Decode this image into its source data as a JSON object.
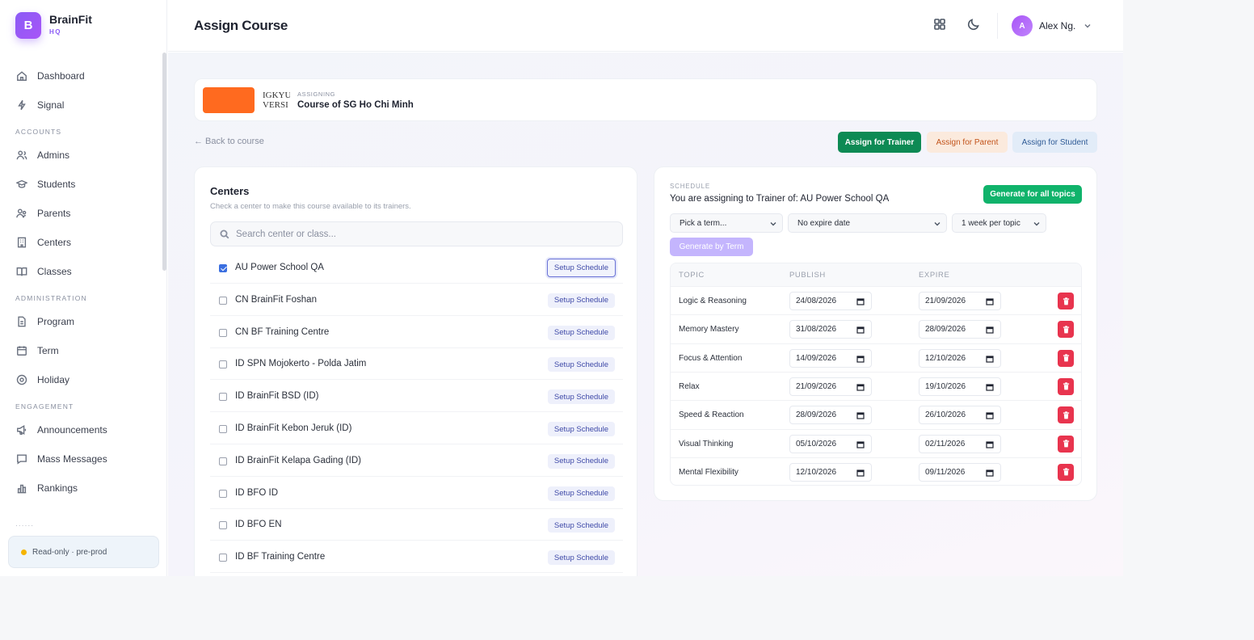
{
  "brand": {
    "logo_letter": "B",
    "name": "BrainFit",
    "sub": "HQ"
  },
  "sidebar": {
    "top_items": [
      {
        "label": "Dashboard",
        "icon": "home-icon"
      },
      {
        "label": "Signal",
        "icon": "signal-icon"
      }
    ],
    "sections": [
      {
        "title": "ACCOUNTS",
        "items": [
          {
            "label": "Admins",
            "icon": "users-icon"
          },
          {
            "label": "Students",
            "icon": "graduation-cap-icon"
          },
          {
            "label": "Parents",
            "icon": "parents-icon"
          },
          {
            "label": "Centers",
            "icon": "building-icon"
          },
          {
            "label": "Classes",
            "icon": "book-open-icon"
          }
        ]
      },
      {
        "title": "ADMINISTRATION",
        "items": [
          {
            "label": "Program",
            "icon": "document-icon"
          },
          {
            "label": "Term",
            "icon": "calendar-icon"
          },
          {
            "label": "Holiday",
            "icon": "holiday-icon"
          }
        ]
      },
      {
        "title": "ENGAGEMENT",
        "items": [
          {
            "label": "Announcements",
            "icon": "megaphone-icon"
          },
          {
            "label": "Mass Messages",
            "icon": "message-icon"
          },
          {
            "label": "Rankings",
            "icon": "bar-chart-icon"
          }
        ]
      }
    ],
    "readonly_label": "Read-only · pre-prod",
    "status_color": "#f5b400"
  },
  "header": {
    "title": "Assign Course",
    "user_initial": "A",
    "user_name": "Alex Ng."
  },
  "course": {
    "assigning_label": "ASSIGNING",
    "name": "Course of SG Ho Chi Minh",
    "mark_line1": "IGKYU",
    "mark_line2": "VERSI",
    "thumb_color": "#ff6a1f"
  },
  "actions": {
    "back": "← Back to course",
    "assign_trainer": "Assign for Trainer",
    "assign_parent": "Assign for Parent",
    "assign_student": "Assign for Student"
  },
  "centers": {
    "title": "Centers",
    "subtitle": "Check a center to make this course available to its trainers.",
    "search_placeholder": "Search center or class...",
    "setup_label": "Setup Schedule",
    "items": [
      {
        "name": "AU Power School QA",
        "checked": true
      },
      {
        "name": "CN BrainFit Foshan",
        "checked": false
      },
      {
        "name": "CN BF Training Centre",
        "checked": false
      },
      {
        "name": "ID SPN Mojokerto - Polda Jatim",
        "checked": false
      },
      {
        "name": "ID BrainFit BSD (ID)",
        "checked": false
      },
      {
        "name": "ID BrainFit Kebon Jeruk (ID)",
        "checked": false
      },
      {
        "name": "ID BrainFit Kelapa Gading (ID)",
        "checked": false
      },
      {
        "name": "ID BFO ID",
        "checked": false
      },
      {
        "name": "ID BFO EN",
        "checked": false
      },
      {
        "name": "ID BF Training Centre",
        "checked": false
      }
    ]
  },
  "schedule": {
    "kicker": "SCHEDULE",
    "title": "You are assigning to Trainer of: AU Power School QA",
    "generate_all": "Generate for all topics",
    "term_select": "Pick a term...",
    "expire_select": "No expire date",
    "interval_select": "1 week per topic",
    "generate_term": "Generate by Term",
    "columns": {
      "topic": "TOPIC",
      "publish": "PUBLISH",
      "expire": "EXPIRE"
    },
    "rows": [
      {
        "topic": "Logic & Reasoning",
        "publish": "24/08/2026",
        "expire": "21/09/2026"
      },
      {
        "topic": "Memory Mastery",
        "publish": "31/08/2026",
        "expire": "28/09/2026"
      },
      {
        "topic": "Focus & Attention",
        "publish": "14/09/2026",
        "expire": "12/10/2026"
      },
      {
        "topic": "Relax",
        "publish": "21/09/2026",
        "expire": "19/10/2026"
      },
      {
        "topic": "Speed & Reaction",
        "publish": "28/09/2026",
        "expire": "26/10/2026"
      },
      {
        "topic": "Visual Thinking",
        "publish": "05/10/2026",
        "expire": "02/11/2026"
      },
      {
        "topic": "Mental Flexibility",
        "publish": "12/10/2026",
        "expire": "09/11/2026"
      }
    ]
  },
  "colors": {
    "accent": "#8b5cf6",
    "trainer": "#0d8a54",
    "generate": "#10b36b",
    "delete": "#e8344e"
  }
}
